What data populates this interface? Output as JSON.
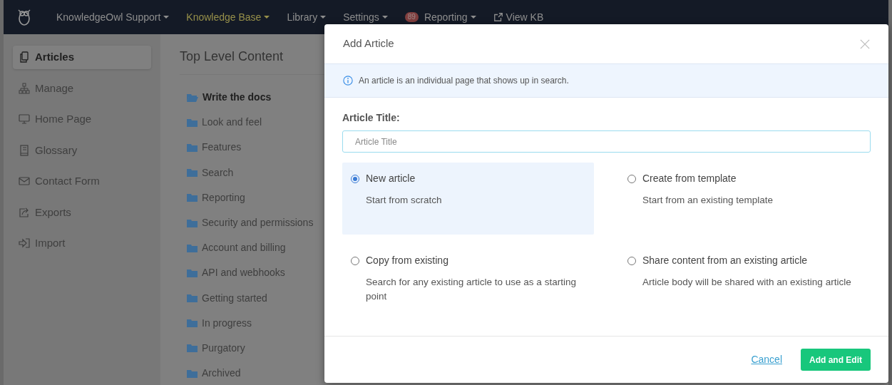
{
  "navbar": {
    "items": [
      {
        "label": "KnowledgeOwl Support",
        "kind": "dropdown",
        "selected": false
      },
      {
        "label": "Knowledge Base",
        "kind": "dropdown",
        "selected": true
      },
      {
        "label": "Library",
        "kind": "dropdown",
        "selected": false
      },
      {
        "label": "Settings",
        "kind": "dropdown",
        "selected": false
      },
      {
        "label": "Reporting",
        "kind": "dropdown",
        "selected": false,
        "badge": "89"
      },
      {
        "label": "View KB",
        "kind": "link",
        "selected": false
      }
    ]
  },
  "sidebar": {
    "items": [
      {
        "label": "Articles",
        "selected": true
      },
      {
        "label": "Manage",
        "selected": false
      },
      {
        "label": "Home Page",
        "selected": false
      },
      {
        "label": "Glossary",
        "selected": false
      },
      {
        "label": "Contact Form",
        "selected": false
      },
      {
        "label": "Exports",
        "selected": false
      },
      {
        "label": "Import",
        "selected": false
      }
    ]
  },
  "content": {
    "title": "Top Level Content",
    "folders": [
      {
        "label": "Write the docs",
        "selected": true
      },
      {
        "label": "Look and feel",
        "selected": false
      },
      {
        "label": "Features",
        "selected": false
      },
      {
        "label": "Search",
        "selected": false
      },
      {
        "label": "Reporting",
        "selected": false
      },
      {
        "label": "Security and permissions",
        "selected": false
      },
      {
        "label": "Account and billing",
        "selected": false
      },
      {
        "label": "API and webhooks",
        "selected": false
      },
      {
        "label": "Getting started",
        "selected": false
      },
      {
        "label": "In progress",
        "selected": false
      },
      {
        "label": "Purgatory",
        "selected": false
      },
      {
        "label": "Archived",
        "selected": false
      }
    ]
  },
  "modal": {
    "title": "Add Article",
    "info": "An article is an individual page that shows up in search.",
    "field_label": "Article Title:",
    "placeholder": "Article Title",
    "options": [
      {
        "title": "New article",
        "description": "Start from scratch",
        "selected": true
      },
      {
        "title": "Create from template",
        "description": "Start from an existing template",
        "selected": false
      },
      {
        "title": "Copy from existing",
        "description": "Search for any existing article to use as a starting point",
        "selected": false
      },
      {
        "title": "Share content from an existing article",
        "description": "Article body will be shared with an existing article",
        "selected": false
      }
    ],
    "cancel": "Cancel",
    "submit": "Add and Edit"
  }
}
